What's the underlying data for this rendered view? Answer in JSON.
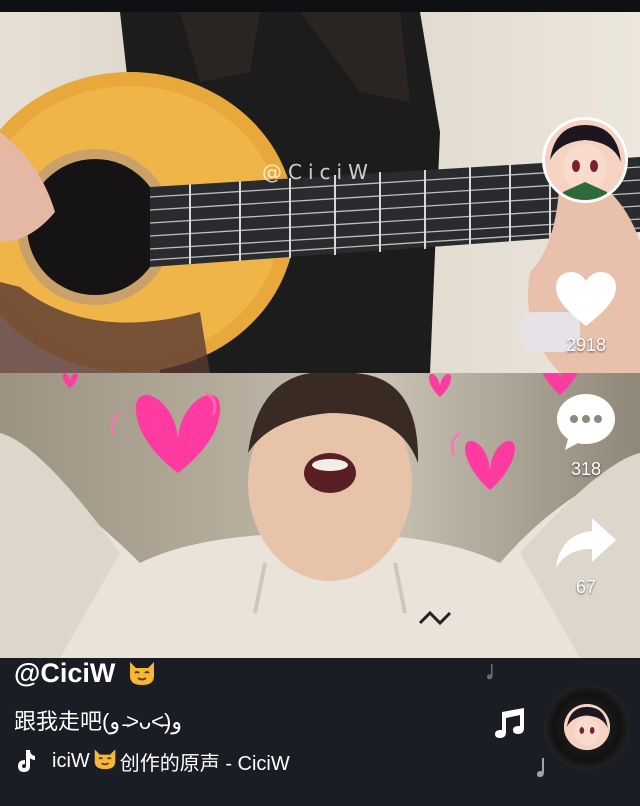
{
  "video": {
    "watermark": "@CiciW"
  },
  "actions": {
    "like_count": "2918",
    "comment_count": "318",
    "share_count": "67"
  },
  "post": {
    "username": "@CiciW",
    "caption": "跟我走吧(و ˃̵ᴗ˂̵)و",
    "music_prefix": "iciW",
    "music_suffix": "创作的原声 - CiciW"
  },
  "icons": [
    "heart-icon",
    "comment-icon",
    "share-icon",
    "tiktok-note-icon",
    "cat-emoji-icon",
    "music-note-icon",
    "music-disc"
  ],
  "colors": {
    "background": "#1a1d24",
    "heart_pink": "#ff3aa0",
    "text": "#ffffff"
  }
}
